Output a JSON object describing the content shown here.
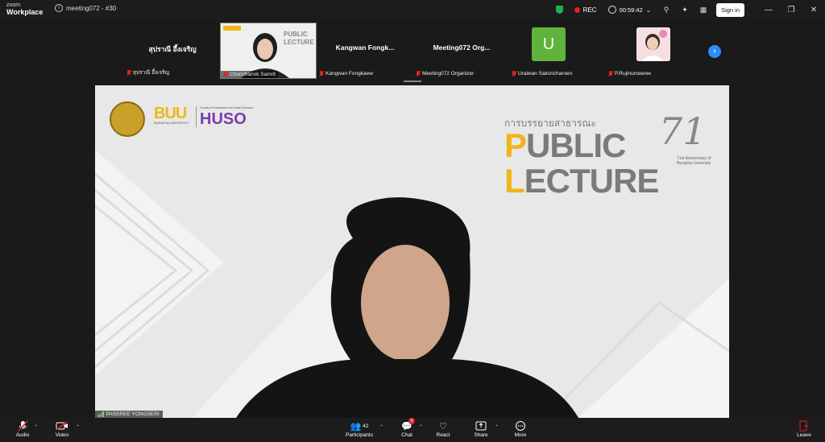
{
  "app": {
    "brand_line1": "zoom",
    "brand_line2": "Workplace",
    "meeting_title": "meeting072 - #30"
  },
  "titlebar": {
    "rec_label": "REC",
    "timer": "00:59:42",
    "signin_label": "Sign in",
    "security_color": "#22b14c",
    "rec_color": "#e02424"
  },
  "thumbnails": [
    {
      "big_name": "สุปราณี อึ้งเจริญ",
      "label": "สุปราณี อึ้งเจริญ",
      "muted": true
    },
    {
      "big_name": "",
      "label": "Chonchanok Samrit",
      "muted": true,
      "video": true
    },
    {
      "big_name": "Kangwan  Fongk...",
      "label": "Kangwan Fongkaew",
      "muted": true
    },
    {
      "big_name": "Meeting072  Org...",
      "label": "Meeting072 Organizer",
      "muted": true
    },
    {
      "avatar_letter": "U",
      "label": "Uraiwan Saksricharoen",
      "muted": true,
      "avatar_color": "#5fb33c"
    },
    {
      "label": "P.Rujinunwaree",
      "muted": true
    }
  ],
  "main_video": {
    "speaker_label": "PASSREE YONGSERI",
    "slide": {
      "buu": "BUU",
      "buu_sub": "BURAPHA UNIVERSITY",
      "huso_small": "Faculty of Humanities and Social Sciences",
      "huso": "HUSO",
      "thai_title": "การบรรยายสาธารณะ",
      "public_first": "P",
      "public_rest": "UBLIC",
      "lecture_first": "L",
      "lecture_rest": "ECTURE",
      "anniv_num": "71",
      "anniv_text": "71st Anniversary of Burapha University",
      "accent": "#f1b519",
      "huso_color": "#7b3ea8"
    }
  },
  "toolbar": {
    "audio": "Audio",
    "video": "Video",
    "participants": "Participants",
    "participants_count": "42",
    "chat": "Chat",
    "chat_badge": "9",
    "react": "React",
    "share": "Share",
    "more": "More",
    "leave": "Leave",
    "leave_color": "#e02424"
  }
}
